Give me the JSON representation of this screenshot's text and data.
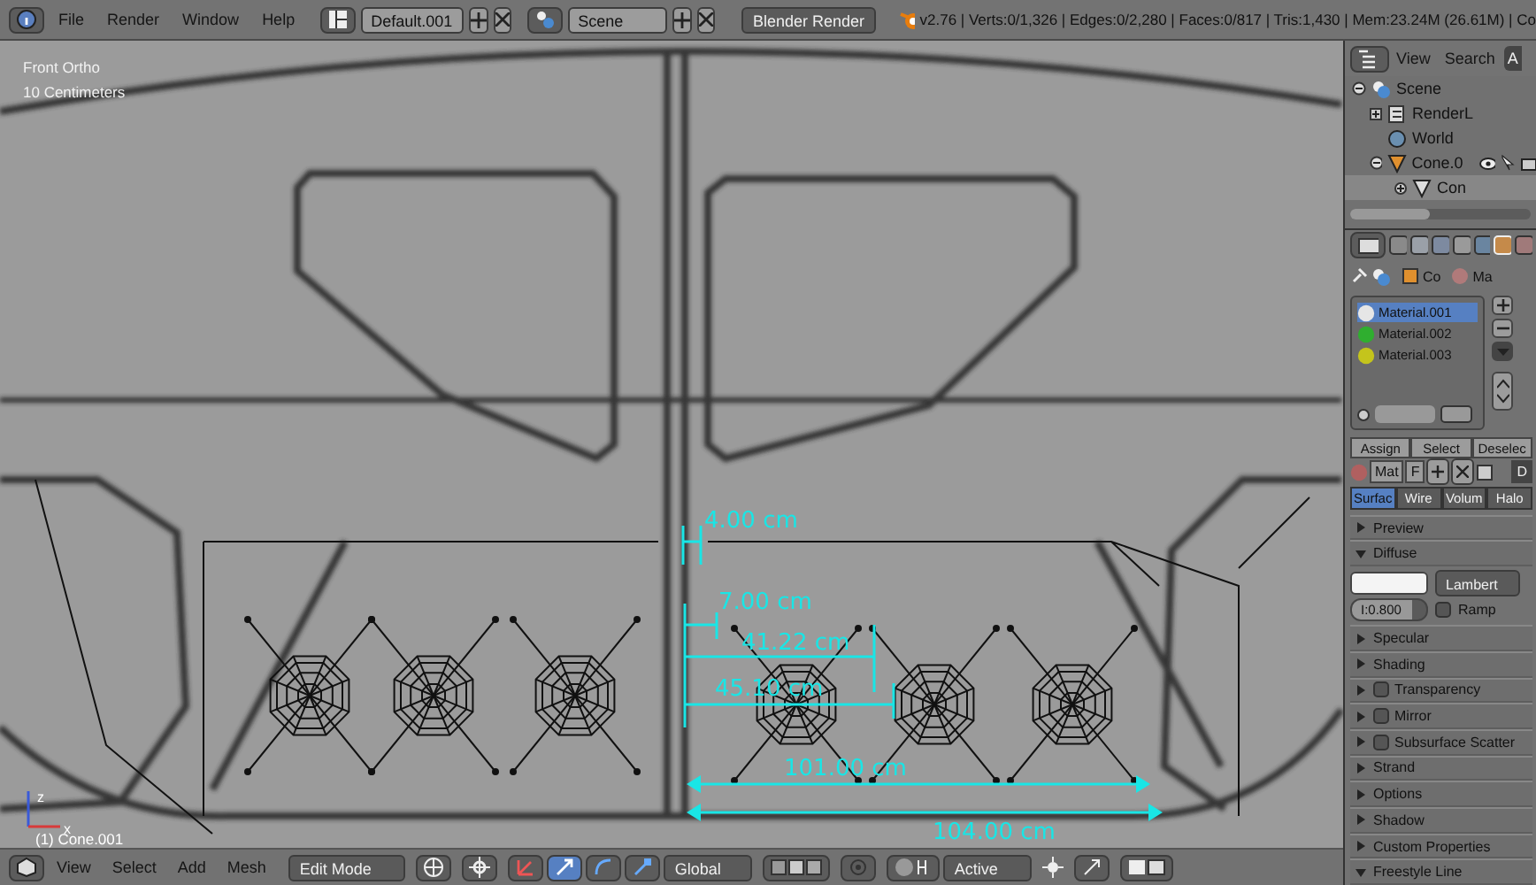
{
  "topbar": {
    "menus": [
      "File",
      "Render",
      "Window",
      "Help"
    ],
    "screen_layout": "Default.001",
    "scene": "Scene",
    "render_engine": "Blender Render",
    "stats": "v2.76 | Verts:0/1,326 | Edges:0/2,280 | Faces:0/817 | Tris:1,430 | Mem:23.24M (26.61M) | Co"
  },
  "viewport": {
    "view_name": "Front Ortho",
    "scale": "10 Centimeters",
    "object_info": "(1) Cone.001",
    "axes": [
      "z",
      "x"
    ],
    "measurements": [
      {
        "text": "4.00 cm"
      },
      {
        "text": "7.00 cm"
      },
      {
        "text": "41.22 cm"
      },
      {
        "text": "45.10 cm"
      },
      {
        "text": "101.00 cm"
      },
      {
        "text": "104.00 cm"
      }
    ]
  },
  "viewport_header": {
    "menus": [
      "View",
      "Select",
      "Add",
      "Mesh"
    ],
    "mode": "Edit Mode",
    "orientation": "Global",
    "snap_target": "Active"
  },
  "outliner": {
    "menus": [
      "View",
      "Search"
    ],
    "filter_tab": "A",
    "tree": [
      {
        "label": "Scene",
        "selected": false,
        "children": [
          {
            "label": "RenderL",
            "selected": false
          },
          {
            "label": "World",
            "selected": false
          },
          {
            "label": "Cone.0",
            "selected": false,
            "children": [
              {
                "label": "Con",
                "selected": true
              }
            ]
          }
        ]
      }
    ]
  },
  "properties": {
    "breadcrumb": [
      "Co",
      "Ma"
    ],
    "material_slots": [
      {
        "name": "Material.001",
        "selected": true,
        "color": "#e6e6e6"
      },
      {
        "name": "Material.002",
        "selected": false,
        "color": "#2fae2f"
      },
      {
        "name": "Material.003",
        "selected": false,
        "color": "#c4c41c"
      }
    ],
    "slot_buttons": [
      "Assign",
      "Select",
      "Deselec"
    ],
    "material_name": "Mat",
    "fake_user": "F",
    "data_menu": "D",
    "render_tabs": [
      {
        "label": "Surfac",
        "selected": true
      },
      {
        "label": "Wire",
        "selected": false
      },
      {
        "label": "Volum",
        "selected": false
      },
      {
        "label": "Halo",
        "selected": false
      }
    ],
    "panels": [
      {
        "label": "Preview",
        "kind": "plain",
        "expanded": false
      },
      {
        "label": "Diffuse",
        "kind": "diffuse",
        "expanded": true,
        "shader": "Lambert",
        "intensity": "I:0.800",
        "level": 0.8,
        "ramp_label": "Ramp",
        "ramp": false
      },
      {
        "label": "Specular",
        "kind": "plain",
        "expanded": false
      },
      {
        "label": "Shading",
        "kind": "plain",
        "expanded": false
      },
      {
        "label": "Transparency",
        "kind": "toggle",
        "expanded": false,
        "checked": false
      },
      {
        "label": "Mirror",
        "kind": "toggle",
        "expanded": false,
        "checked": false
      },
      {
        "label": "Subsurface Scatter",
        "kind": "toggle",
        "expanded": false,
        "checked": false
      },
      {
        "label": "Strand",
        "kind": "plain",
        "expanded": false
      },
      {
        "label": "Options",
        "kind": "plain",
        "expanded": false
      },
      {
        "label": "Shadow",
        "kind": "plain",
        "expanded": false
      },
      {
        "label": "Custom Properties",
        "kind": "plain",
        "expanded": false
      },
      {
        "label": "Freestyle Line",
        "kind": "plain",
        "expanded": true
      }
    ]
  }
}
